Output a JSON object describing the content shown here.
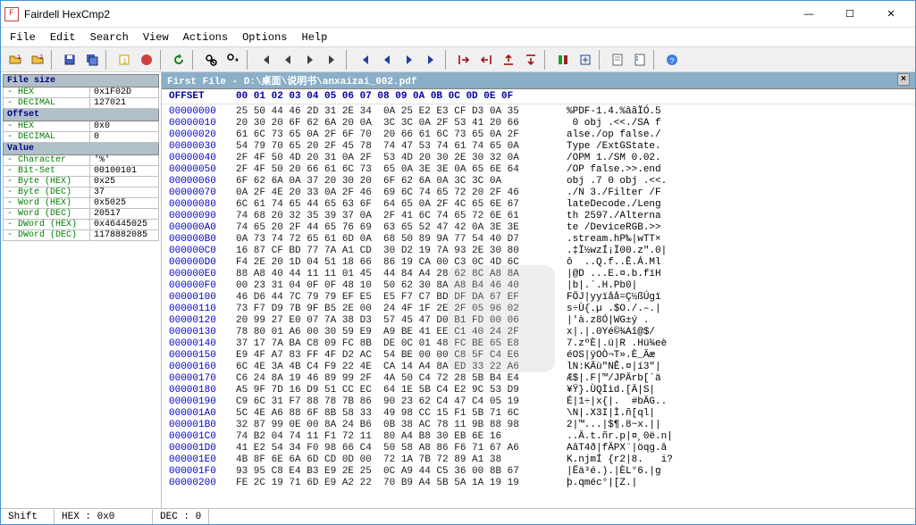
{
  "title": "Fairdell HexCmp2",
  "menu": [
    "File",
    "Edit",
    "Search",
    "View",
    "Actions",
    "Options",
    "Help"
  ],
  "sidebar": {
    "sections": [
      {
        "header": "File size",
        "rows": [
          [
            "- HEX",
            "0x1F02D"
          ],
          [
            "- DECIMAL",
            "127021"
          ]
        ]
      },
      {
        "header": "Offset",
        "rows": [
          [
            "- HEX",
            "0x0"
          ],
          [
            "- DECIMAL",
            "0"
          ]
        ]
      },
      {
        "header": "Value",
        "rows": [
          [
            "- Character",
            "'%'"
          ],
          [
            "- Bit-Set",
            "00100101"
          ],
          [
            "- Byte (HEX)",
            "0x25"
          ],
          [
            "- Byte (DEC)",
            "37"
          ],
          [
            "- Word (HEX)",
            "0x5025"
          ],
          [
            "- Word (DEC)",
            "20517"
          ],
          [
            "- DWord (HEX)",
            "0x46445025"
          ],
          [
            "- DWord (DEC)",
            "1178882085"
          ]
        ]
      }
    ]
  },
  "file_header": "First File - D:\\桌面\\说明书\\anxaizai_002.pdf",
  "hex_header": {
    "offset": "OFFSET",
    "cols": "00 01 02 03 04 05 06 07  08 09 0A 0B 0C 0D 0E 0F"
  },
  "rows": [
    {
      "o": "00000000",
      "h": "25 50 44 46 2D 31 2E 34  0A 25 E2 E3 CF D3 0A 35",
      "a": "%PDF-1.4.%âãÏÓ.5"
    },
    {
      "o": "00000010",
      "h": "20 30 20 6F 62 6A 20 0A  3C 3C 0A 2F 53 41 20 66",
      "a": " 0 obj .<<./SA f"
    },
    {
      "o": "00000020",
      "h": "61 6C 73 65 0A 2F 6F 70  20 66 61 6C 73 65 0A 2F",
      "a": "alse./op false./"
    },
    {
      "o": "00000030",
      "h": "54 79 70 65 20 2F 45 78  74 47 53 74 61 74 65 0A",
      "a": "Type /ExtGState."
    },
    {
      "o": "00000040",
      "h": "2F 4F 50 4D 20 31 0A 2F  53 4D 20 30 2E 30 32 0A",
      "a": "/OPM 1./SM 0.02."
    },
    {
      "o": "00000050",
      "h": "2F 4F 50 20 66 61 6C 73  65 0A 3E 3E 0A 65 6E 64",
      "a": "/OP false.>>.end"
    },
    {
      "o": "00000060",
      "h": "6F 62 6A 0A 37 20 30 20  6F 62 6A 0A 3C 3C 0A    ",
      "a": "obj .7 0 obj .<<."
    },
    {
      "o": "00000070",
      "h": "0A 2F 4E 20 33 0A 2F 46  69 6C 74 65 72 20 2F 46",
      "a": "./N 3./Filter /F"
    },
    {
      "o": "00000080",
      "h": "6C 61 74 65 44 65 63 6F  64 65 0A 2F 4C 65 6E 67",
      "a": "lateDecode./Leng"
    },
    {
      "o": "00000090",
      "h": "74 68 20 32 35 39 37 0A  2F 41 6C 74 65 72 6E 61",
      "a": "th 2597./Alterna"
    },
    {
      "o": "000000A0",
      "h": "74 65 20 2F 44 65 76 69  63 65 52 47 42 0A 3E 3E",
      "a": "te /DeviceRGB.>>"
    },
    {
      "o": "000000B0",
      "h": "0A 73 74 72 65 61 6D 0A  68 50 89 9A 77 54 40 D7",
      "a": ".stream.hP‰|wTT×"
    },
    {
      "o": "000000C0",
      "h": "16 87 CF BD 77 7A A1 CD  30 D2 19 7A 93 2E 30 80",
      "a": ".‡Ï½wzÍ¡Ï00.z\".0|"
    },
    {
      "o": "000000D0",
      "h": "F4 2E 20 1D 04 51 18 66  86 19 CA 00 C3 0C 4D 6C",
      "a": "ô  ..Q.f..Ê.Á.Ml"
    },
    {
      "o": "000000E0",
      "h": "88 A8 40 44 11 11 01 45  44 84 A4 28 62 8C A8 8A",
      "a": "|@D ...E.¤.b.fïH"
    },
    {
      "o": "000000F0",
      "h": "00 23 31 04 0F 0F 48 10  50 62 30 8A A8 B4 46 40",
      "a": "|b|.´.H.Pb0|    "
    },
    {
      "o": "00000100",
      "h": "46 D6 44 7C 79 79 EF E5  E5 F7 C7 BD DF DA 67 EF",
      "a": "FÖJ|yyïåå=Ç½ßÚgï"
    },
    {
      "o": "00000110",
      "h": "73 F7 D9 7B 9F B5 2E 00  24 4F 1F 2E 2F 05 96 02",
      "a": "s÷Ù{.µ .$O./.–.| "
    },
    {
      "o": "00000120",
      "h": "20 99 27 E0 07 7A 38 D3  57 45 47 D0 B1 FD 00 06",
      "a": "|'à.z8Ó|WG±ý .  "
    },
    {
      "o": "00000130",
      "h": "78 80 01 A6 00 30 59 E9  A9 BE 41 EE C1 40 24 2F",
      "a": "x|.|.0Yé©¾Aî@$/"
    },
    {
      "o": "00000140",
      "h": "37 17 7A BA C8 09 FC 8B  DE 0C 01 48 FC BE 65 E8",
      "a": "7.zºÈ|.ü|R .Hü¾eè"
    },
    {
      "o": "00000150",
      "h": "E9 4F A7 83 FF 4F D2 AC  54 BE 00 00 C8 5F C4 E6",
      "a": "éOS|ÿOÒ¬T».È_Äæ"
    },
    {
      "o": "00000160",
      "h": "6C 4E 3A 4B C4 F9 22 4E  CA 14 A4 8A ED 33 22 A6",
      "a": "lN:KÄù\"NÊ.¤|í3\"|"
    },
    {
      "o": "00000170",
      "h": "C6 24 8A 19 46 89 99 2F  4A 50 C4 72 28 5B B4 E4",
      "a": "Æ$|.F|™/JPÄrb[´ä"
    },
    {
      "o": "00000180",
      "h": "A5 9F 7D 16 D9 51 CC EC  64 1E 5B C4 E2 9C 53 D9",
      "a": "¥Ÿ}.ÙQÌìd.[Ä|S|"
    },
    {
      "o": "00000190",
      "h": "C9 6C 31 F7 88 78 7B 86  90 23 62 C4 47 C4 05 19",
      "a": "É|1÷|x{|.  #bÄG.."
    },
    {
      "o": "000001A0",
      "h": "5C 4E A6 88 6F 8B 58 33  49 98 CC 15 F1 5B 71 6C",
      "a": "\\N|.X3I|Ì.ñ[ql| "
    },
    {
      "o": "000001B0",
      "h": "32 87 99 0E 00 8A 24 B6  0B 38 AC 78 11 9B 88 98",
      "a": "2|™...|$¶.8~x.||"
    },
    {
      "o": "000001C0",
      "h": "74 B2 04 74 11 F1 72 11  80 A4 B8 30 EB 6E 16",
      "a": "..Ä.t.ñr.p|¤¸0ë.n|"
    },
    {
      "o": "000001D0",
      "h": "41 E2 54 34 F0 98 66 C4  50 58 A8 86 F6 71 67 A6",
      "a": "AâT4ð|fÄPX¨|öqg.â"
    },
    {
      "o": "000001E0",
      "h": "4B 8F 6E 6A 6D CD 0D 00  72 1A 7B 72 89 A1 38",
      "a": "K.njmÍ {r2|8.   i?"
    },
    {
      "o": "000001F0",
      "h": "93 95 C8 E4 B3 E9 2E 25  0C A9 44 C5 36 00 8B 67",
      "a": "|Ëä³é.).|ÈL°6.|g"
    },
    {
      "o": "00000200",
      "h": "FE 2C 19 71 6D E9 A2 22  70 B9 A4 5B 5A 1A 19 19",
      "a": "þ.qméc°|[Z.|    "
    }
  ],
  "status": {
    "shift": "Shift",
    "hex": "HEX : 0x0",
    "dec": "DEC : 0"
  }
}
